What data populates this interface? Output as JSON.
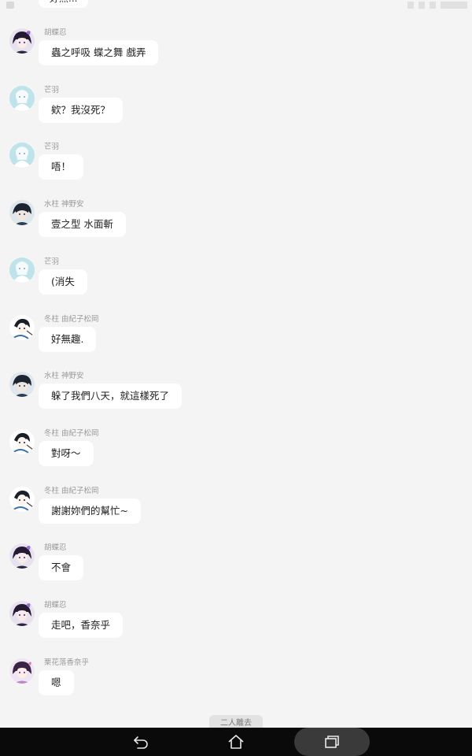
{
  "top_bubble_text": "好無...",
  "messages": [
    {
      "sender": "胡蝶忍",
      "text": "蟲之呼吸 蝶之舞 戲弄",
      "avatar": "shinobu"
    },
    {
      "sender": "芒羽",
      "text": "欸？我沒死？",
      "avatar": "white"
    },
    {
      "sender": "芒羽",
      "text": "唔！",
      "avatar": "white"
    },
    {
      "sender": "水柱 神野安",
      "text": "壹之型 水面斬",
      "avatar": "dark"
    },
    {
      "sender": "芒羽",
      "text": "(消失",
      "avatar": "white"
    },
    {
      "sender": "冬柱 由紀子松岡",
      "text": "好無趣.",
      "avatar": "sketch"
    },
    {
      "sender": "水柱 神野安",
      "text": "躲了我們八天，就這樣死了",
      "avatar": "dark"
    },
    {
      "sender": "冬柱 由紀子松岡",
      "text": "對呀～",
      "avatar": "sketch"
    },
    {
      "sender": "冬柱 由紀子松岡",
      "text": "謝謝妳們的幫忙~",
      "avatar": "sketch"
    },
    {
      "sender": "胡蝶忍",
      "text": "不會",
      "avatar": "shinobu"
    },
    {
      "sender": "胡蝶忍",
      "text": "走吧，香奈乎",
      "avatar": "shinobu"
    },
    {
      "sender": "栗花落香奈乎",
      "text": "嗯",
      "avatar": "kanao"
    }
  ],
  "system_notice": "二人離去",
  "navigation": {
    "back_icon": "back-icon",
    "home_icon": "home-icon",
    "recents_icon": "recents-icon"
  },
  "colors": {
    "background": "#f4f4f4",
    "bubble": "#ffffff",
    "nav_bar": "#0a0a0a"
  }
}
